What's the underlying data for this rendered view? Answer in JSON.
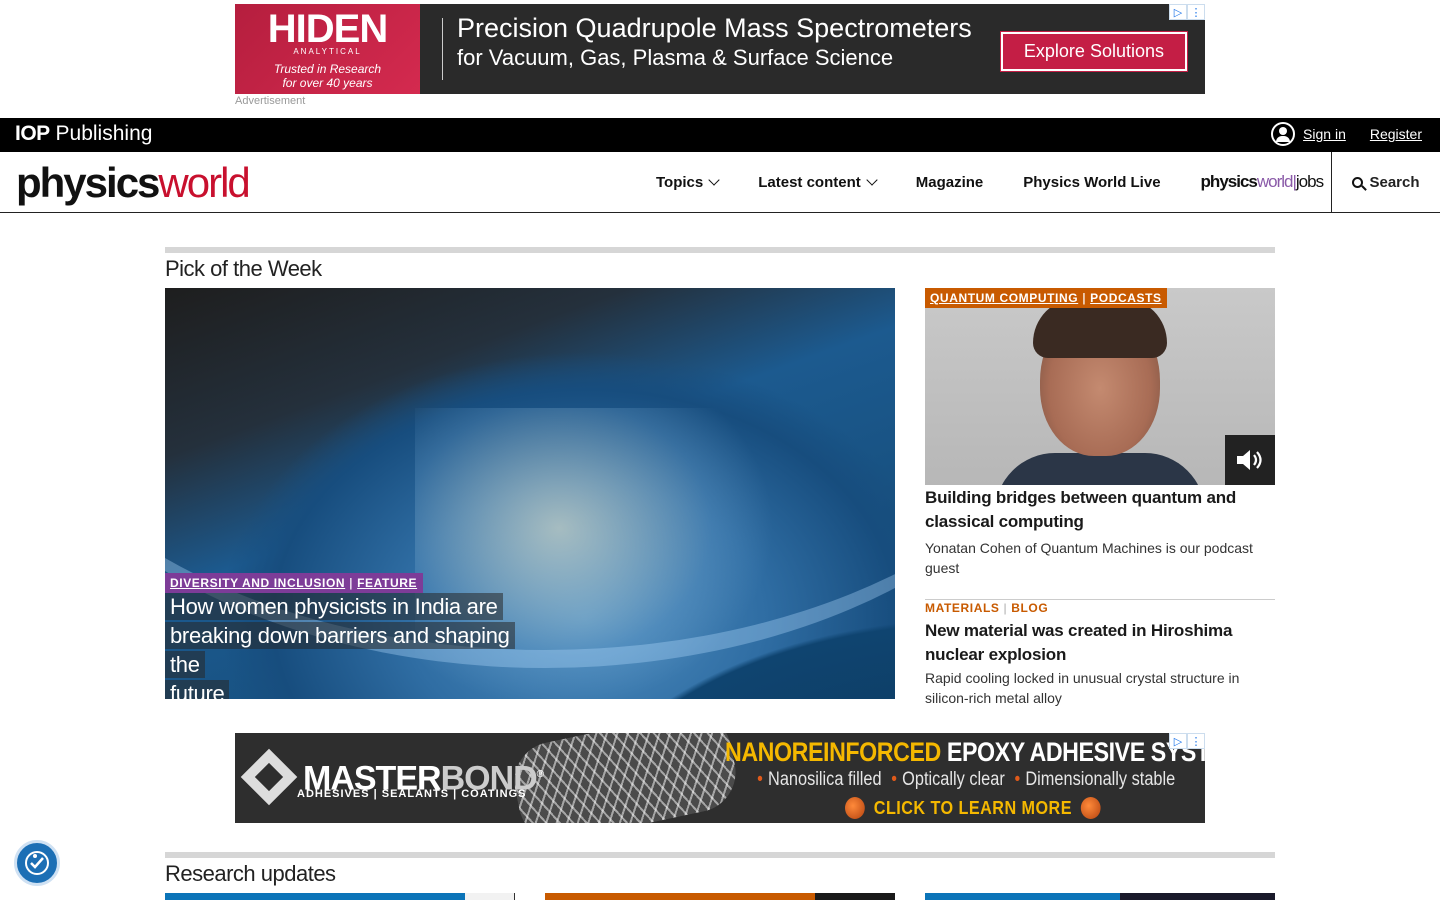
{
  "top_ad": {
    "brand_logo": "HIDEN",
    "brand_sub": "ANALYTICAL",
    "brand_tagline_1": "Trusted in Research",
    "brand_tagline_2": "for over 40 years",
    "headline": "Precision Quadrupole Mass Spectrometers",
    "subline": "for Vacuum, Gas, Plasma & Surface Science",
    "cta": "Explore Solutions",
    "label": "Advertisement"
  },
  "iop": {
    "logo_bold": "IOP",
    "logo_text": "Publishing",
    "sign_in": "Sign in",
    "register": "Register"
  },
  "nav": {
    "logo_a": "physics",
    "logo_b": "world",
    "items": [
      {
        "label": "Topics",
        "dropdown": true
      },
      {
        "label": "Latest content",
        "dropdown": true
      },
      {
        "label": "Magazine",
        "dropdown": false
      },
      {
        "label": "Physics World Live",
        "dropdown": false
      }
    ],
    "jobs_logo": {
      "p": "physics",
      "w": "world",
      "bar": "|",
      "j": "jobs"
    },
    "search": "Search"
  },
  "pick": {
    "title": "Pick of the Week",
    "hero": {
      "tags": [
        "DIVERSITY AND INCLUSION",
        "FEATURE"
      ],
      "headline_lines": [
        "How women physicists in India are",
        "breaking down barriers and shaping the",
        "future"
      ]
    },
    "podcast": {
      "tags": [
        "QUANTUM COMPUTING",
        "PODCASTS"
      ],
      "title": "Building bridges between quantum and classical computing",
      "summary": "Yonatan Cohen of Quantum Machines is our podcast guest"
    },
    "article2": {
      "tags": [
        "MATERIALS",
        "BLOG"
      ],
      "title": "New material was created in Hiroshima nuclear explosion",
      "summary": "Rapid cooling locked in unusual crystal structure in silicon-rich metal alloy"
    }
  },
  "mid_ad": {
    "brand": "MASTER",
    "brand2": "BOND",
    "registered": "®",
    "sub": "ADHESIVES | SEALANTS | COATINGS",
    "head_y": "NANOREINFORCED",
    "head_w": "EPOXY ADHESIVE SYSTEMS",
    "bullets": [
      "Nanosilica filled",
      "Optically clear",
      "Dimensionally stable"
    ],
    "cta": "CLICK TO LEARN MORE"
  },
  "research": {
    "title": "Research updates",
    "strip_colors": [
      "#0b74b8",
      "#c85a00",
      "#0b74b8"
    ]
  },
  "colors": {
    "accent_red": "#c8102e",
    "feature_purple": "#7d3c98",
    "tag_orange": "#c85a00"
  }
}
